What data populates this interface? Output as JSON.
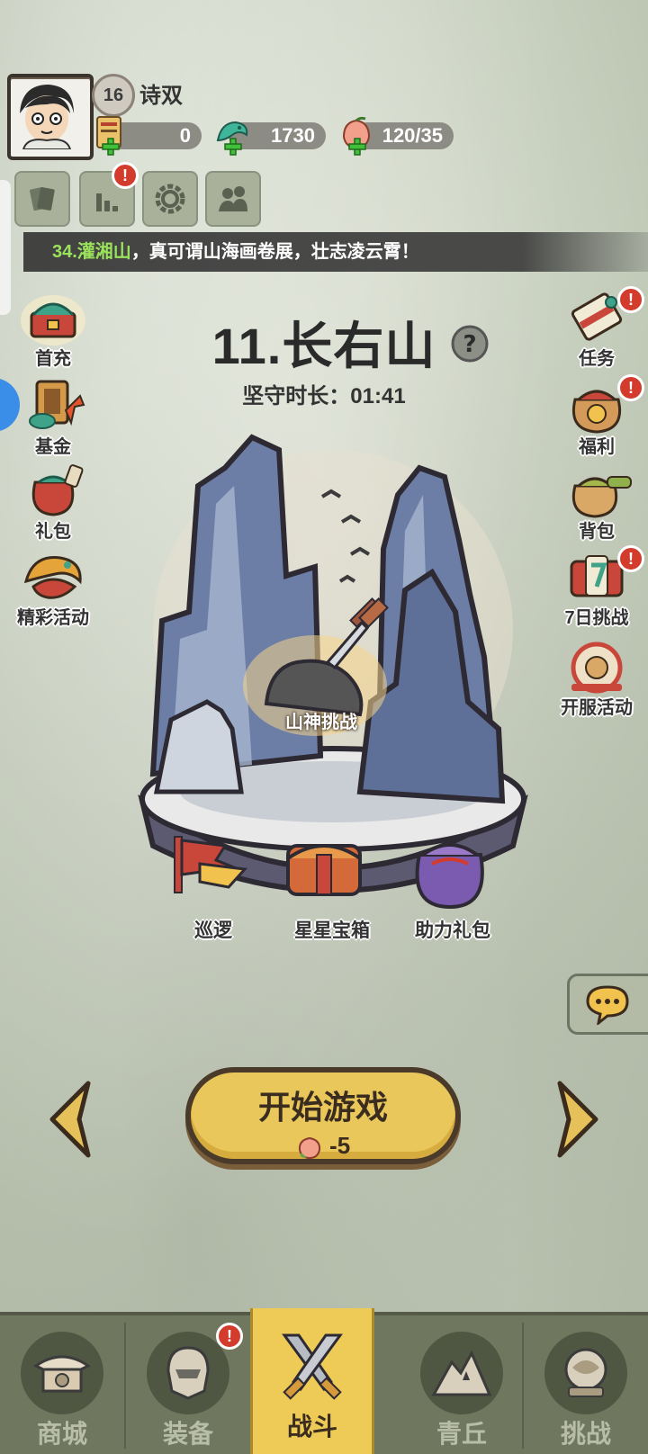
{
  "player": {
    "level": "16",
    "name": "诗双"
  },
  "resources": [
    {
      "icon": "scroll-ticket-icon",
      "value": "0"
    },
    {
      "icon": "jade-dragon-icon",
      "value": "1730"
    },
    {
      "icon": "peach-stamina-icon",
      "value": "120/35"
    }
  ],
  "ticker": {
    "highlight": "34.灌湘山",
    "text": "，真可谓山海画卷展，壮志凌云霄！"
  },
  "stage": {
    "title": "11.长右山",
    "guard_label": "坚守时长：01:41"
  },
  "left_menu": [
    {
      "label": "首充"
    },
    {
      "label": "基金"
    },
    {
      "label": "礼包"
    },
    {
      "label": "精彩活动"
    }
  ],
  "right_menu": [
    {
      "label": "任务"
    },
    {
      "label": "福利"
    },
    {
      "label": "背包"
    },
    {
      "label": "7日挑战"
    },
    {
      "label": "开服活动"
    }
  ],
  "scene": {
    "challenge_label": "山神挑战"
  },
  "scene_items": [
    {
      "label": "巡逻"
    },
    {
      "label": "星星宝箱"
    },
    {
      "label": "助力礼包"
    }
  ],
  "start_button": {
    "title": "开始游戏",
    "cost": "-5"
  },
  "alert_mark": "!",
  "nav": [
    {
      "label": "商城"
    },
    {
      "label": "装备"
    },
    {
      "label": "战斗"
    },
    {
      "label": "青丘"
    },
    {
      "label": "挑战"
    }
  ],
  "colors": {
    "accent": "#eecb56",
    "alert": "#d33b2c",
    "nav_bg": "#70775f"
  }
}
